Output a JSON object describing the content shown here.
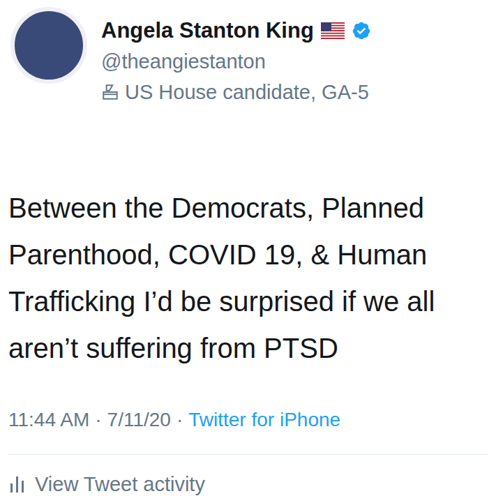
{
  "author": {
    "name": "Angela Stanton King",
    "verified": true,
    "handle": "@theangiestanton",
    "label": "US House candidate, GA-5"
  },
  "tweet": {
    "text": "Between the Democrats, Planned Parenthood, COVID 19, & Human Trafficking I’d be surprised if we all aren’t suffering from PTSD"
  },
  "meta": {
    "time": "11:44 AM",
    "separator": "·",
    "date": "7/11/20",
    "source": "Twitter for iPhone"
  },
  "activity": {
    "label": "View Tweet activity"
  }
}
